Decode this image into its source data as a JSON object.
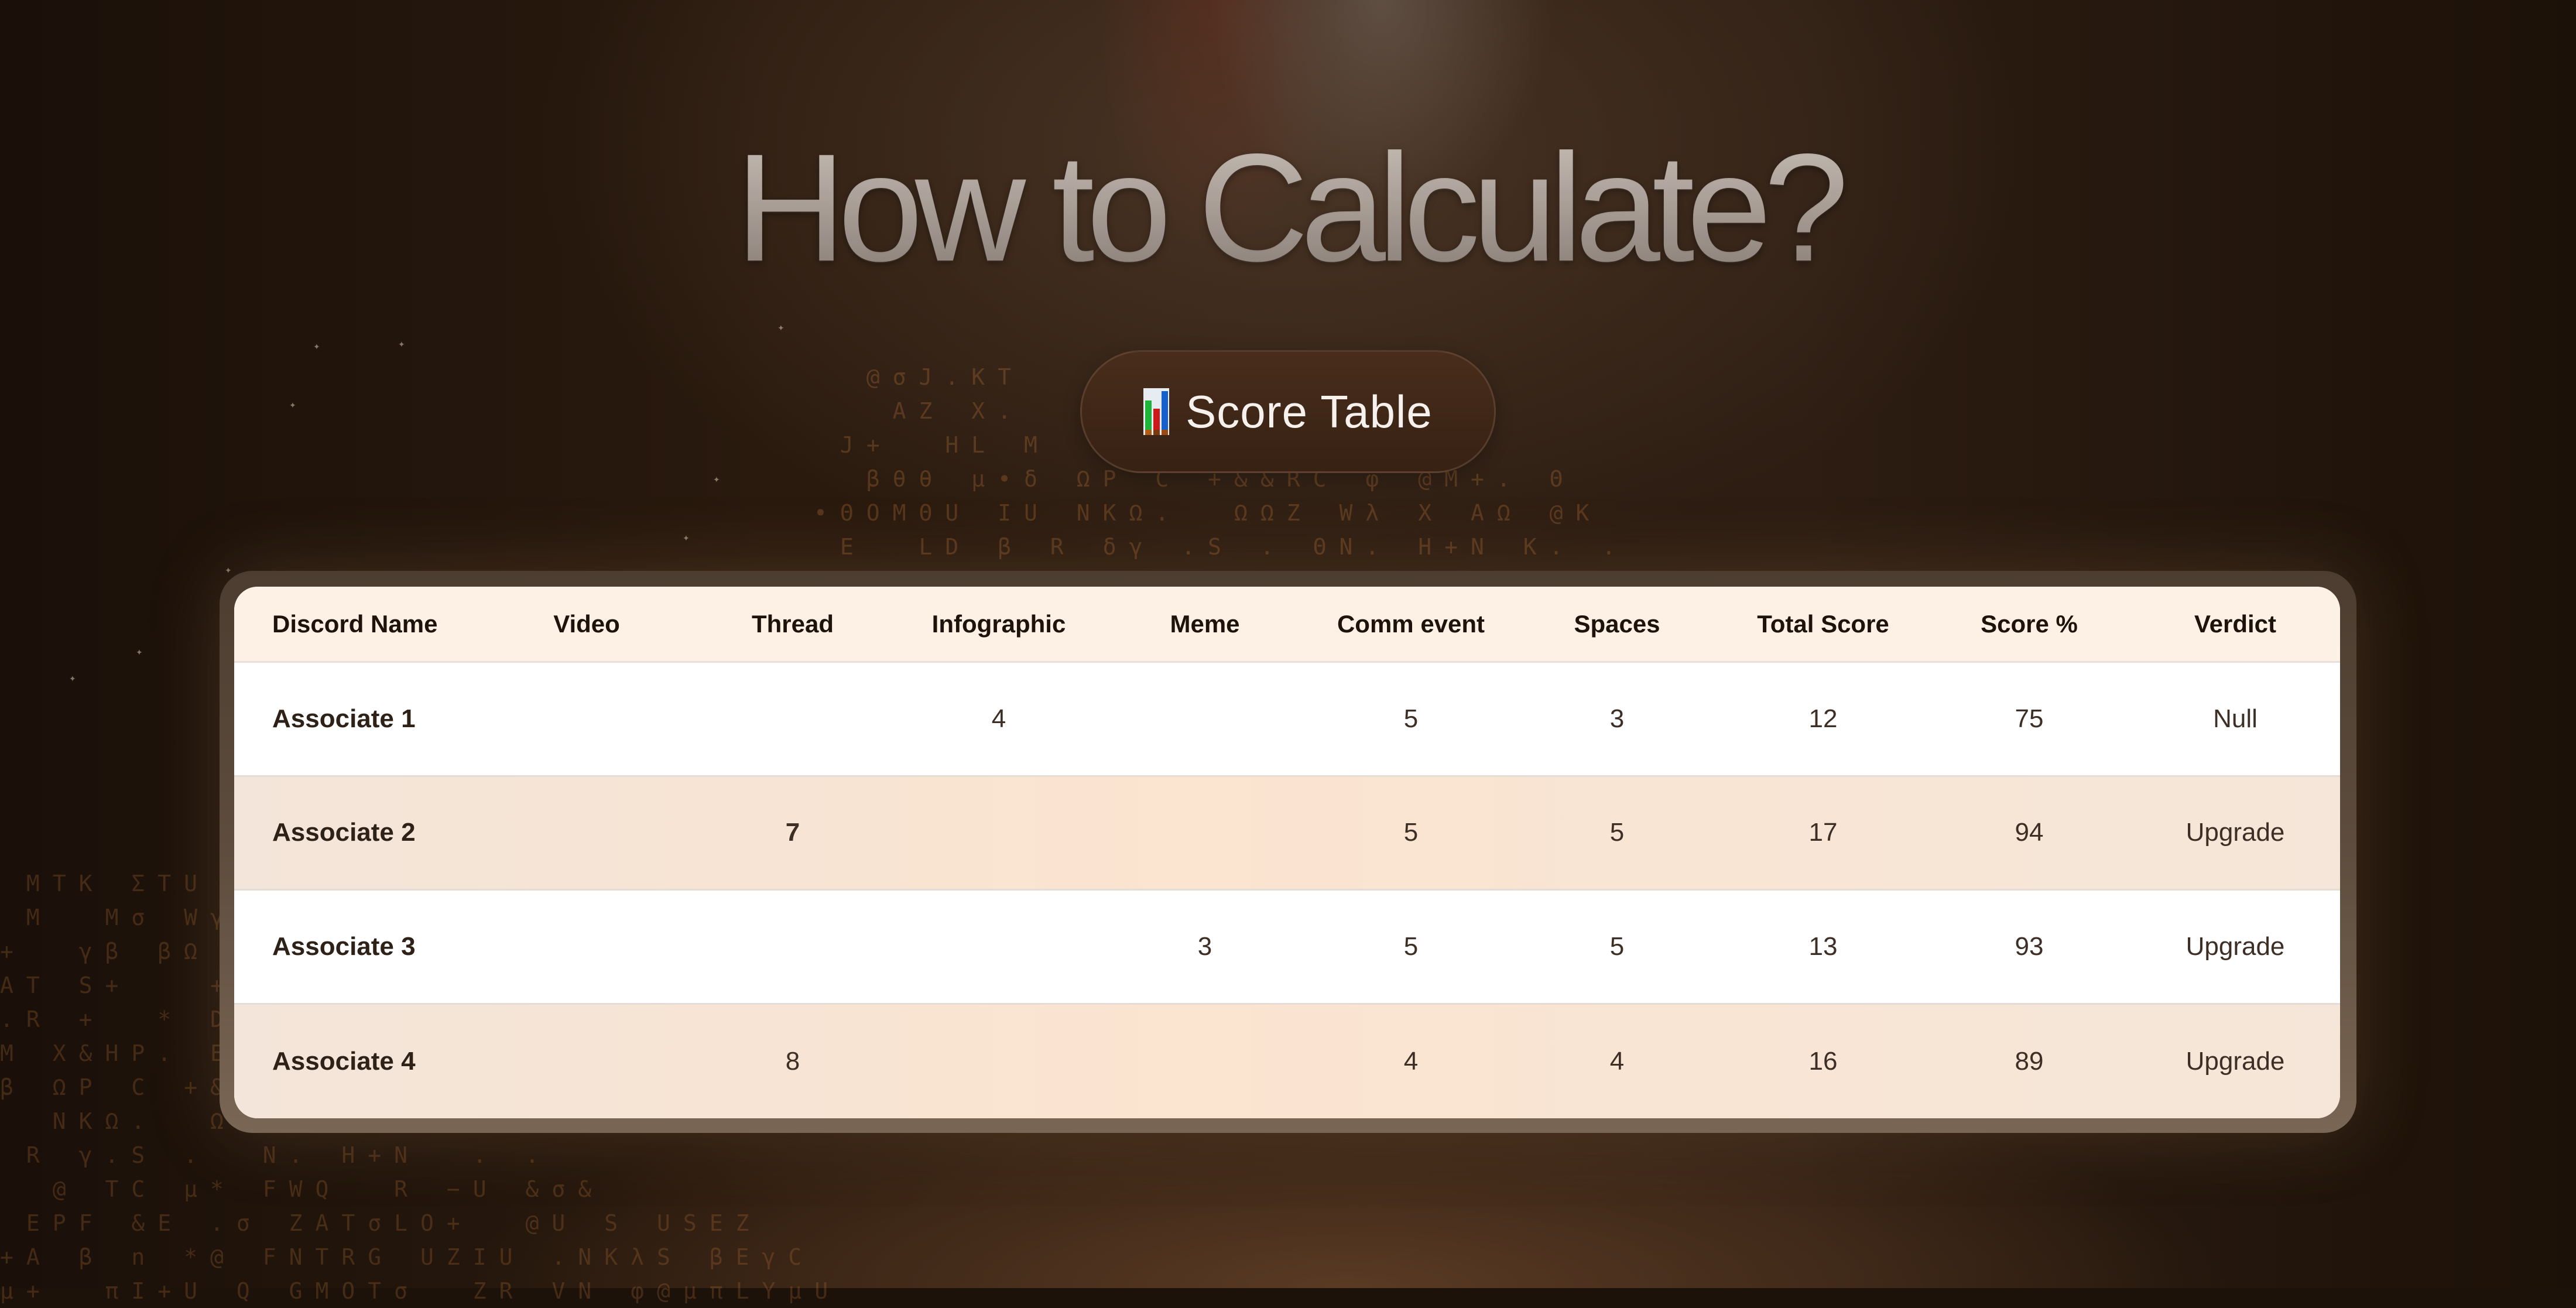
{
  "title": "How to Calculate?",
  "pill": {
    "icon": "bar-chart-icon",
    "label": "Score Table"
  },
  "table": {
    "columns": [
      "Discord Name",
      "Video",
      "Thread",
      "Infographic",
      "Meme",
      "Comm event",
      "Spaces",
      "Total Score",
      "Score %",
      "Verdict"
    ],
    "rows": [
      {
        "name": "Associate 1",
        "video": "",
        "thread": "",
        "infographic": "4",
        "meme": "",
        "comm_event": "5",
        "spaces": "3",
        "total_score": "12",
        "score_pct": "75",
        "verdict": "Null"
      },
      {
        "name": "Associate 2",
        "video": "",
        "thread": "7",
        "infographic": "",
        "meme": "",
        "comm_event": "5",
        "spaces": "5",
        "total_score": "17",
        "score_pct": "94",
        "verdict": "Upgrade"
      },
      {
        "name": "Associate 3",
        "video": "",
        "thread": "",
        "infographic": "",
        "meme": "3",
        "comm_event": "5",
        "spaces": "5",
        "total_score": "13",
        "score_pct": "93",
        "verdict": "Upgrade"
      },
      {
        "name": "Associate 4",
        "video": "",
        "thread": "8",
        "infographic": "",
        "meme": "",
        "comm_event": "4",
        "spaces": "4",
        "total_score": "16",
        "score_pct": "89",
        "verdict": "Upgrade"
      }
    ]
  },
  "background_glyphs": {
    "center": "  @σJ.KT\n   AZ X.\n J+  HL M\n  βθθ μ•δ ΩP C +&&RC φ @M+. Θ\n•ΘOMΘU IU NKΩ.  ΩΩZ Wλ X AΩ @K\n E  LD β R δγ .S . ΘN. H+N K. .\n  W−+& W  @ TC μ* FWQ  R −U &σ&",
    "bottom": " MTK ΣTU\n M  Mσ Wγ\n+  γβ βΩ\nAT S+   +\n.R +  * D\nM X&HP. E\nβ ΩP C +&\n  NKΩ.  Ω\n R γ.S .  N. H+N  . .\n  @ TC μ* FWQ  R −U &σ&\n EPF &E .σ ZATσLO+  @U S USEZ\n+A β n *@ FNTRG UZIU .NKλS βEγC\nμ+  πI+U Q GMOTσ  ZR VN φ@μπLYμU"
  },
  "colors": {
    "background": "#1c120a",
    "header_row": "#fdf0e5",
    "alt_row": "#f8e6d7",
    "text_dark": "#2e2218"
  }
}
